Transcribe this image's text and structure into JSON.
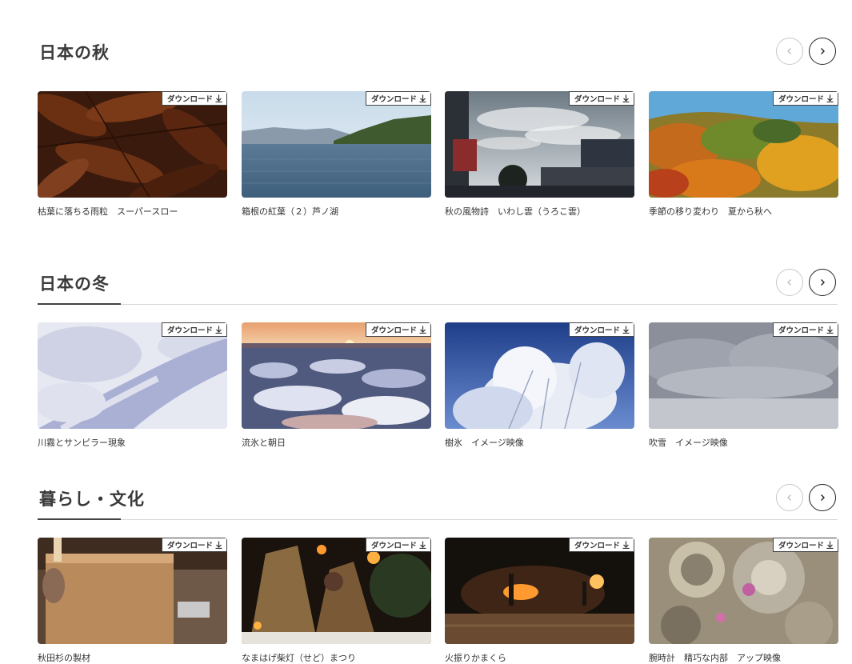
{
  "download_label": "ダウンロード",
  "sections": [
    {
      "title": "日本の秋",
      "items": [
        {
          "caption": "枯葉に落ちる雨粒　スーパースロー"
        },
        {
          "caption": "箱根の紅葉（２）芦ノ湖"
        },
        {
          "caption": "秋の風物詩　いわし雲（うろこ雲）"
        },
        {
          "caption": "季節の移り変わり　夏から秋へ"
        }
      ]
    },
    {
      "title": "日本の冬",
      "items": [
        {
          "caption": "川霧とサンピラー現象"
        },
        {
          "caption": "流氷と朝日"
        },
        {
          "caption": "樹氷　イメージ映像"
        },
        {
          "caption": "吹雪　イメージ映像"
        }
      ]
    },
    {
      "title": "暮らし・文化",
      "items": [
        {
          "caption": "秋田杉の製材"
        },
        {
          "caption": "なまはげ柴灯（せど）まつり"
        },
        {
          "caption": "火振りかまくら"
        },
        {
          "caption": "腕時計　精巧な内部　アップ映像"
        }
      ]
    }
  ]
}
